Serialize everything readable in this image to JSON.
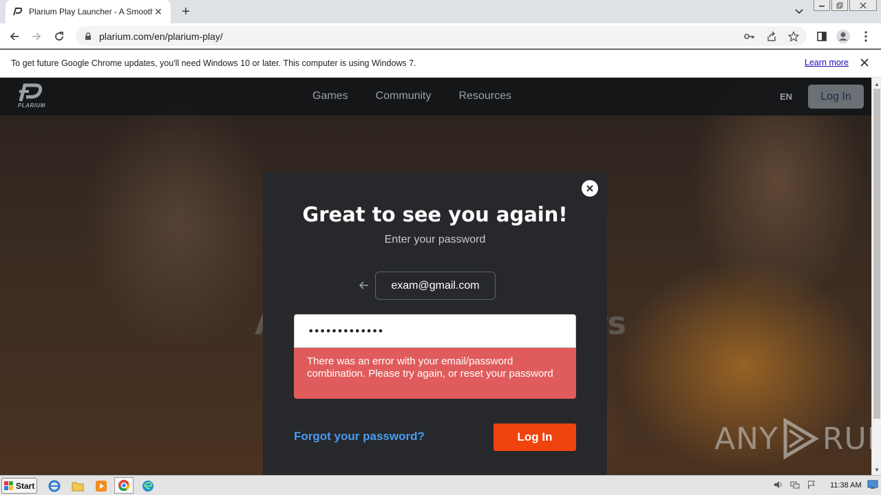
{
  "browser": {
    "tab_title": "Plarium Play Launcher - A Smoother G",
    "url": "plarium.com/en/plarium-play/"
  },
  "infobar": {
    "message": "To get future Google Chrome updates, you'll need Windows 10 or later. This computer is using Windows 7.",
    "learn_more": "Learn more"
  },
  "site_nav": {
    "logo_text": "PLARIUM",
    "links": [
      "Games",
      "Community",
      "Resources"
    ],
    "lang": "EN",
    "login_label": "Log In"
  },
  "hero": {
    "left_fragment": "A",
    "right_fragment": "rs"
  },
  "modal": {
    "title": "Great to see you again!",
    "subtitle": "Enter your password",
    "email": "exam@gmail.com",
    "password_mask": "•••••••••••••",
    "error": "There was an error with your email/password combination. Please try again, or reset your password",
    "forgot_label": "Forgot your password?",
    "login_label": "Log In"
  },
  "watermark": {
    "left": "ANY",
    "right": "RUN"
  },
  "taskbar": {
    "start_label": "Start",
    "clock": "11:38 AM"
  }
}
